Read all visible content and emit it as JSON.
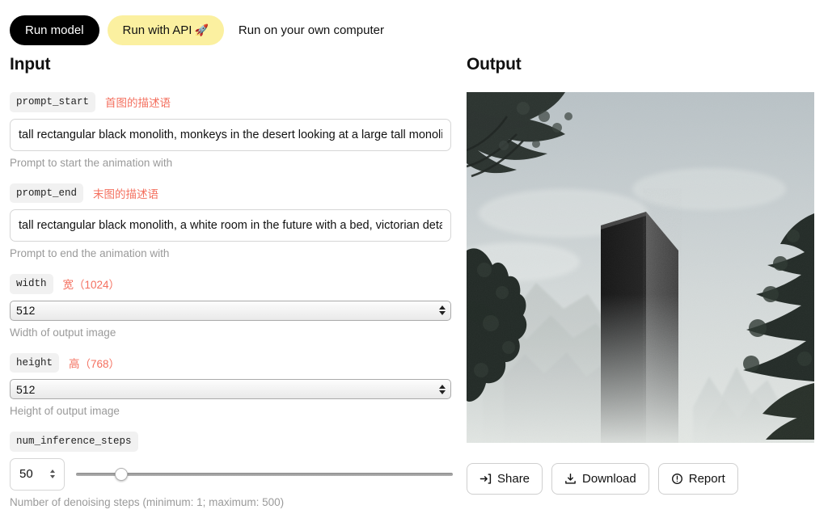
{
  "tabs": {
    "run_model": "Run model",
    "run_api": "Run with API",
    "run_api_icon": "rocket-emoji",
    "rocket": "🚀",
    "run_own": "Run on your own computer"
  },
  "input": {
    "title": "Input",
    "fields": [
      {
        "name": "prompt_start",
        "label": "prompt_start",
        "annotation": "首图的描述语",
        "value": "tall rectangular black monolith, monkeys in the desert looking at a large tall monolit",
        "helper": "Prompt to start the animation with"
      },
      {
        "name": "prompt_end",
        "label": "prompt_end",
        "annotation": "末图的描述语",
        "value": "tall rectangular black monolith, a white room in the future with a bed, victorian deta",
        "helper": "Prompt to end the animation with"
      },
      {
        "name": "width",
        "label": "width",
        "annotation": "宽（1024）",
        "value": "512",
        "helper": "Width of output image"
      },
      {
        "name": "height",
        "label": "height",
        "annotation": "高（768）",
        "value": "512",
        "helper": "Height of output image"
      },
      {
        "name": "num_inference_steps",
        "label": "num_inference_steps",
        "annotation": "",
        "value": "50",
        "helper": "Number of denoising steps (minimum: 1; maximum: 500)",
        "slider_min": 1,
        "slider_max": 500,
        "slider_percent": 12
      }
    ]
  },
  "output": {
    "title": "Output",
    "image_alt": "tall black monolith between misty mountains and dark trees",
    "buttons": [
      {
        "label": "Share",
        "icon": "share-arrow-icon"
      },
      {
        "label": "Download",
        "icon": "download-icon"
      },
      {
        "label": "Report",
        "icon": "report-exclamation-icon"
      }
    ]
  },
  "colors": {
    "accent_yellow": "#fbf0a0",
    "annotation_red": "#f4705f",
    "chip_bg": "#f1f1f1",
    "helper_gray": "#9a9a9a"
  }
}
